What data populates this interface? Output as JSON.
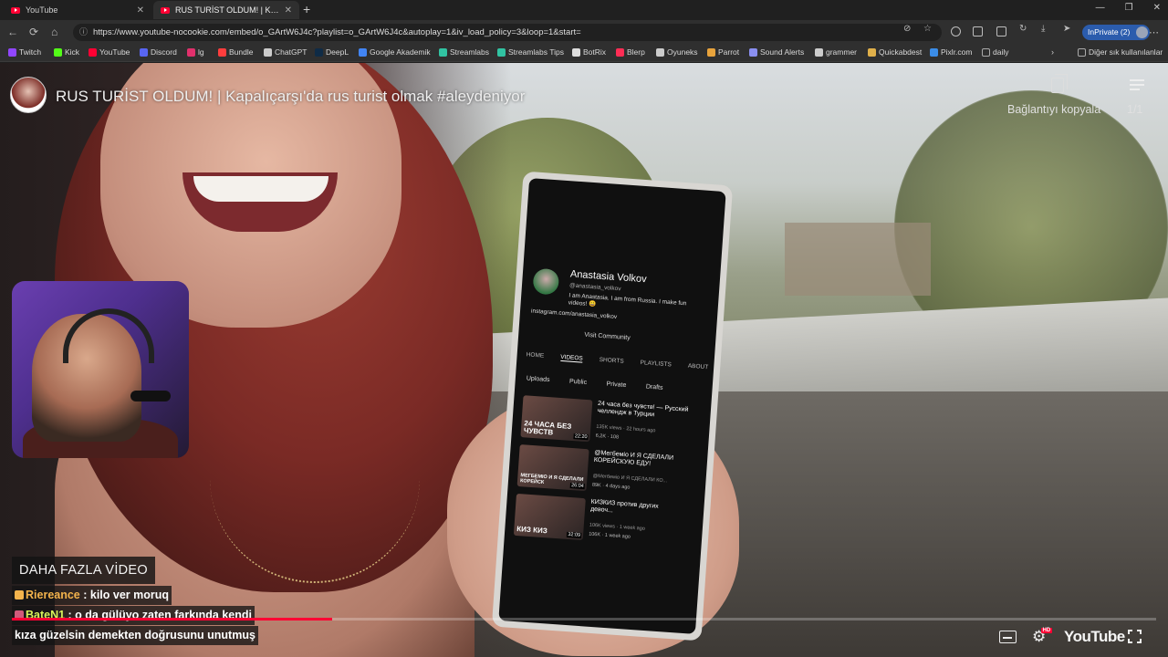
{
  "browser": {
    "tabs": [
      {
        "label": "YouTube",
        "close": "✕",
        "active": false
      },
      {
        "label": "RUS TURİST OLDUM! | Kapalıçarşı",
        "close": "✕",
        "active": true
      }
    ],
    "new_tab": "+",
    "url": "https://www.youtube-nocookie.com/embed/o_GArtW6J4c?playlist=o_GArtW6J4c&autoplay=1&iv_load_policy=3&loop=1&start=",
    "inprivate_label": "InPrivate (2)",
    "window_controls": [
      "—",
      "❐",
      "✕"
    ],
    "bookmarks": [
      {
        "label": "Twitch",
        "color": "#9146ff"
      },
      {
        "label": "Kick",
        "color": "#53fc18"
      },
      {
        "label": "YouTube",
        "color": "#ff0033"
      },
      {
        "label": "Discord",
        "color": "#5865f2"
      },
      {
        "label": "lg",
        "color": "#e1306c"
      },
      {
        "label": "Bundle",
        "color": "#ff3d3d"
      },
      {
        "label": "ChatGPT",
        "color": "#cccccc"
      },
      {
        "label": "DeepL",
        "color": "#0f2b46"
      },
      {
        "label": "Google Akademik",
        "color": "#4285f4"
      },
      {
        "label": "Streamlabs",
        "color": "#31c3a2"
      },
      {
        "label": "Streamlabs Tips",
        "color": "#31c3a2"
      },
      {
        "label": "BotRix",
        "color": "#dddddd"
      },
      {
        "label": "Blerp",
        "color": "#ff2d55"
      },
      {
        "label": "Oyuneks",
        "color": "#cccccc"
      },
      {
        "label": "Parrot",
        "color": "#e8a33c"
      },
      {
        "label": "Sound Alerts",
        "color": "#8a8ff0"
      },
      {
        "label": "grammer",
        "color": "#cccccc"
      },
      {
        "label": "Quickabdest",
        "color": "#e0b04a"
      },
      {
        "label": "Pixlr.com",
        "color": "#3b8de8"
      },
      {
        "label": "daily",
        "color": "#aaaaaa"
      }
    ],
    "bookmarks_other": "Diğer sık kullanılanlar"
  },
  "player": {
    "title": "RUS TURİST OLDUM! | Kapalıçarşı'da rus turist olmak #aleydeniyor",
    "copy_link_label": "Bağlantıyı kopyala",
    "playlist_count": "1/1",
    "more_videos": "DAHA FAZLA VİDEO",
    "youtube_logo": "YouTube",
    "hd_label": "HD",
    "progress": 0.28
  },
  "phone": {
    "channel_name": "Anastasia Volkov",
    "handle": "@anastasia_volkov",
    "bio": "I am Anastasia. I am from Russia. I make fun videos! 😀",
    "link": "instagram.com/anastasia_volkov",
    "community": "Visit Community",
    "tabs": [
      "HOME",
      "VIDEOS",
      "SHORTS",
      "PLAYLISTS",
      "ABOUT"
    ],
    "subtabs": [
      "Uploads",
      "Public",
      "Private",
      "Drafts"
    ],
    "videos": [
      {
        "thumb": "24 ЧАСА БЕЗ ЧУВСТВ",
        "duration": "22:20",
        "title": "24 часа без чувств! — Русский челлендж в Турции",
        "meta": "135K views · 22 hours ago",
        "stats": "6,2K · 108"
      },
      {
        "thumb": "МЕГБЕМІО И Я СДЕЛАЛИ КОРЕЙСК",
        "duration": "26:04",
        "title": "@Мегбеміо И Я СДЕЛАЛИ КОРЕЙСКУЮ ЕДУ!",
        "meta": "@Мегбеміо И Я СДЕЛАЛИ КО...",
        "stats": "89K · 4 days ago"
      },
      {
        "thumb": "КИЗ КИЗ",
        "duration": "32:09",
        "title": "КИЗКИЗ против других девоч...",
        "meta": "106K views · 1 week ago",
        "stats": "106K · 1 week ago"
      }
    ]
  },
  "chat": [
    {
      "user": "Riereance",
      "message": " : kilo ver moruq",
      "badge_color": "#f3b34c"
    },
    {
      "user": "BateN1",
      "message": " : o da gülüyo zaten farkında kendi",
      "badge_color": "#d05a7a"
    },
    {
      "user": "",
      "message": "kıza güzelsin demekten doğrusunu unutmuş",
      "badge_color": ""
    }
  ]
}
